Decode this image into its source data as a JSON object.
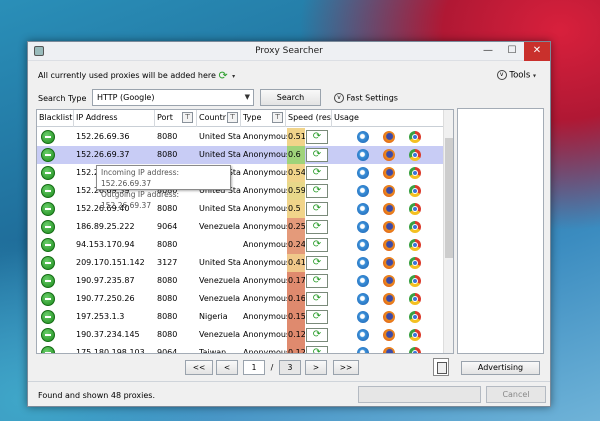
{
  "window": {
    "title": "Proxy Searcher"
  },
  "notice": "All currently used proxies will be added here",
  "tools_label": "Tools",
  "search_type": {
    "label": "Search Type",
    "value": "HTTP (Google)"
  },
  "search_button": "Search",
  "fast_settings": "Fast Settings",
  "columns": {
    "blacklist": "Blacklist",
    "ip": "IP Address",
    "port": "Port",
    "country": "Countr",
    "type": "Type",
    "speed": "Speed (res",
    "usage": "Usage"
  },
  "rows": [
    {
      "ip": "152.26.69.36",
      "port": "8080",
      "country": "United States",
      "type": "Anonymous",
      "speed": "0.51",
      "speed_color": "#f1d48a"
    },
    {
      "ip": "152.26.69.37",
      "port": "8080",
      "country": "United States",
      "type": "Anonymous",
      "speed": "0.6",
      "speed_color": "#9fd37a"
    },
    {
      "ip": "152.26.69.38",
      "port": "8080",
      "country": "United States",
      "type": "Anonymous",
      "speed": "0.54",
      "speed_color": "#f1d48a"
    },
    {
      "ip": "152.26.69.39",
      "port": "8080",
      "country": "United States",
      "type": "Anonymous",
      "speed": "0.59",
      "speed_color": "#e8d88a"
    },
    {
      "ip": "152.26.69.40",
      "port": "8080",
      "country": "United States",
      "type": "Anonymous",
      "speed": "0.5",
      "speed_color": "#f1d48a"
    },
    {
      "ip": "186.89.25.222",
      "port": "9064",
      "country": "Venezuela",
      "type": "Anonymous",
      "speed": "0.25",
      "speed_color": "#e49a7a"
    },
    {
      "ip": "94.153.170.94",
      "port": "8080",
      "country": "",
      "type": "Anonymous",
      "speed": "0.24",
      "speed_color": "#e49a7a"
    },
    {
      "ip": "209.170.151.142",
      "port": "3127",
      "country": "United States",
      "type": "Anonymous",
      "speed": "0.41",
      "speed_color": "#f0c88a"
    },
    {
      "ip": "190.97.235.87",
      "port": "8080",
      "country": "Venezuela",
      "type": "Anonymous",
      "speed": "0.17",
      "speed_color": "#df8a6e"
    },
    {
      "ip": "190.77.250.26",
      "port": "8080",
      "country": "Venezuela",
      "type": "Anonymous",
      "speed": "0.16",
      "speed_color": "#df8a6e"
    },
    {
      "ip": "197.253.1.3",
      "port": "8080",
      "country": "Nigeria",
      "type": "Anonymous",
      "speed": "0.15",
      "speed_color": "#df8a6e"
    },
    {
      "ip": "190.37.234.145",
      "port": "8080",
      "country": "Venezuela",
      "type": "Anonymous",
      "speed": "0.12",
      "speed_color": "#df8a6e"
    },
    {
      "ip": "175.180.198.103",
      "port": "9064",
      "country": "Taiwan",
      "type": "Anonymous",
      "speed": "0.12",
      "speed_color": "#df8a6e"
    }
  ],
  "tooltip": {
    "incoming": "Incoming IP address: 152.26.69.37",
    "outgoing": "Outgoing IP address: 152.26.69.37"
  },
  "pager": {
    "first": "<<",
    "prev": "<",
    "page": "1",
    "of": "/",
    "total": "3",
    "next": ">",
    "last": ">>"
  },
  "advertising_button": "Advertising",
  "status_text": "Found and shown 48 proxies.",
  "cancel_button": "Cancel",
  "selected_row": 1
}
